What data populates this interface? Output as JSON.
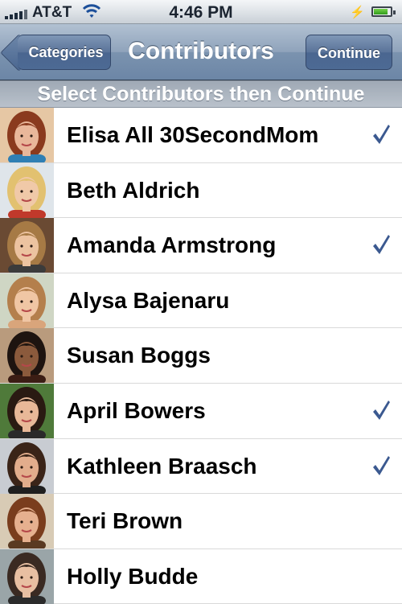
{
  "status": {
    "carrier": "AT&T",
    "time": "4:46 PM"
  },
  "nav": {
    "title": "Contributors",
    "back_label": "Categories",
    "continue_label": "Continue"
  },
  "section_header": "Select Contributors then Continue",
  "colors": {
    "check": "#3b5990",
    "nav": "#6c86a6"
  },
  "contributors": [
    {
      "name": "Elisa All 30SecondMom",
      "checked": true,
      "hair": "#8a3a1e",
      "skin": "#e9b79a",
      "bg": "#e6c7a4",
      "shirt": "#2f7fb4"
    },
    {
      "name": "Beth Aldrich",
      "checked": false,
      "hair": "#e2c170",
      "skin": "#f0c9a8",
      "bg": "#dfe5ea",
      "shirt": "#c0392b"
    },
    {
      "name": "Amanda Armstrong",
      "checked": true,
      "hair": "#a67a45",
      "skin": "#ecc3a0",
      "bg": "#6a4a33",
      "shirt": "#3b3b3b"
    },
    {
      "name": "Alysa Bajenaru",
      "checked": false,
      "hair": "#b47f4c",
      "skin": "#f0c6a4",
      "bg": "#cfd6c4",
      "shirt": "#d9a57b"
    },
    {
      "name": "Susan Boggs",
      "checked": false,
      "hair": "#1e1410",
      "skin": "#8b5a3c",
      "bg": "#b99b7d",
      "shirt": "#3b1d14"
    },
    {
      "name": "April Bowers",
      "checked": true,
      "hair": "#2a1a12",
      "skin": "#e8b898",
      "bg": "#4f7a3a",
      "shirt": "#2a2a2a"
    },
    {
      "name": "Kathleen Braasch",
      "checked": true,
      "hair": "#3a2418",
      "skin": "#e2ad8c",
      "bg": "#c8ccd2",
      "shirt": "#1f1f1f"
    },
    {
      "name": "Teri Brown",
      "checked": false,
      "hair": "#7a3d1d",
      "skin": "#e6b08f",
      "bg": "#d8cbb5",
      "shirt": "#5a3a22"
    },
    {
      "name": "Holly Budde",
      "checked": false,
      "hair": "#3a2a22",
      "skin": "#e8bfa2",
      "bg": "#9aa5a8",
      "shirt": "#2b2b2b"
    }
  ]
}
